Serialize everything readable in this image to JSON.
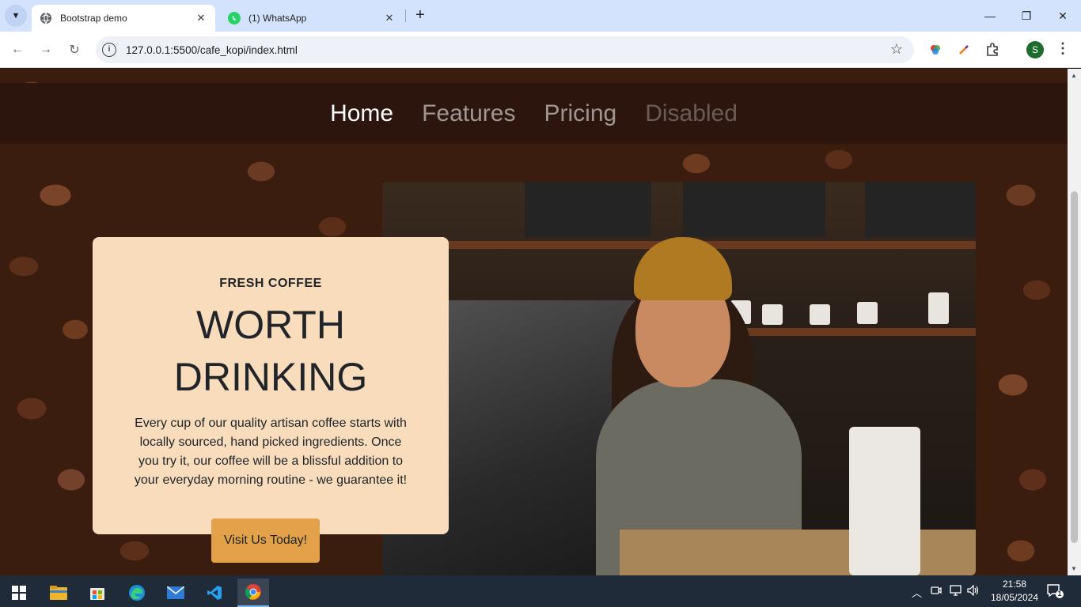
{
  "browser": {
    "tabs": [
      {
        "title": "Bootstrap demo",
        "active": true,
        "favicon": "globe-icon"
      },
      {
        "title": "(1) WhatsApp",
        "active": false,
        "favicon": "whatsapp-icon"
      }
    ],
    "address": "127.0.0.1:5500/cafe_kopi/index.html",
    "profile_initial": "S"
  },
  "site": {
    "nav": [
      {
        "label": "Home",
        "state": "active"
      },
      {
        "label": "Features",
        "state": "normal"
      },
      {
        "label": "Pricing",
        "state": "normal"
      },
      {
        "label": "Disabled",
        "state": "disabled"
      }
    ],
    "hero": {
      "subheading": "FRESH COFFEE",
      "heading_line1": "WORTH",
      "heading_line2": "DRINKING",
      "body": "Every cup of our quality artisan coffee starts with locally sourced, hand picked ingredients. Once you try it, our coffee will be a blissful addition to your everyday morning routine - we guarantee it!",
      "button": "Visit Us Today!"
    }
  },
  "taskbar": {
    "time": "21:58",
    "date": "18/05/2024",
    "notification_count": "1"
  },
  "colors": {
    "nav_bg": "#2b150d",
    "card_bg": "#f8dcbc",
    "button_bg": "#e3a24a",
    "tabbar_bg": "#d3e3fd"
  }
}
